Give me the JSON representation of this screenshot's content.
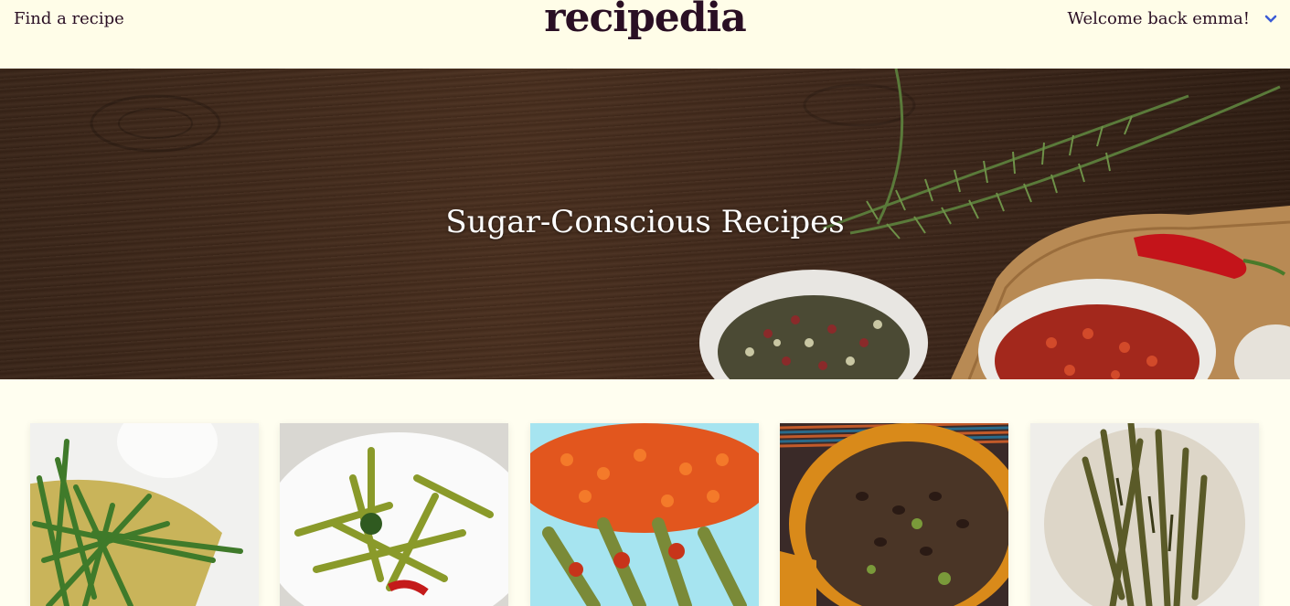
{
  "header": {
    "find_link": "Find a recipe",
    "logo": "recipedia",
    "welcome": "Welcome back emma!",
    "menu_icon": "chevron-down-icon"
  },
  "hero": {
    "title": "Sugar-Conscious Recipes"
  },
  "recipes": [
    {
      "image": "green-beans-colander"
    },
    {
      "image": "pickled-beans-bowl"
    },
    {
      "image": "beans-tomato-sauce"
    },
    {
      "image": "black-beans-pot"
    },
    {
      "image": "roasted-green-beans"
    }
  ],
  "colors": {
    "background": "#fffef0",
    "text": "#2a0f24",
    "accent": "#3b5bd6"
  }
}
